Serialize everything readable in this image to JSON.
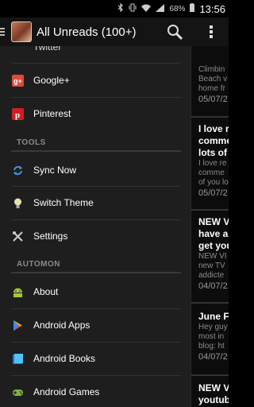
{
  "status_bar": {
    "battery": "68%",
    "time": "13:56"
  },
  "action_bar": {
    "title": "All Unreads (100+)"
  },
  "drawer": {
    "partial_item": "Twitter",
    "items_top": [
      {
        "label": "Google+",
        "icon": "google-plus-icon",
        "color": "#dd4b39"
      },
      {
        "label": "Pinterest",
        "icon": "pinterest-icon",
        "color": "#cb2027"
      }
    ],
    "tools_header": "TOOLS",
    "tools": [
      {
        "label": "Sync Now",
        "icon": "sync-icon"
      },
      {
        "label": "Switch Theme",
        "icon": "lightbulb-icon"
      },
      {
        "label": "Settings",
        "icon": "tools-icon"
      }
    ],
    "automon_header": "AUTOMON",
    "automon": [
      {
        "label": "About",
        "icon": "android-icon"
      },
      {
        "label": "Android Apps",
        "icon": "play-store-icon"
      },
      {
        "label": "Android Books",
        "icon": "books-icon"
      },
      {
        "label": "Android Games",
        "icon": "gamepad-icon"
      }
    ]
  },
  "feed": [
    {
      "text1": "Climbin",
      "text2": "Beach v",
      "text3": "home fr",
      "date": "05/07/2"
    },
    {
      "title1": "I love r",
      "title2": "comme",
      "title3": "lots of",
      "text1": "I love re",
      "text2": "comme",
      "text3": "of you lo",
      "date": "05/07/2"
    },
    {
      "title1": "NEW VI",
      "title2": "have a",
      "title3": "get you",
      "text1": "NEW VI",
      "text2": "new TV",
      "text3": "addicte",
      "date": "04/07/2"
    },
    {
      "title1": "June F",
      "text1": "Hey guy",
      "text2": "most in",
      "text3": "blog: ht",
      "date": "04/07/2"
    },
    {
      "title1": "NEW VI",
      "title2": "youtub"
    }
  ]
}
